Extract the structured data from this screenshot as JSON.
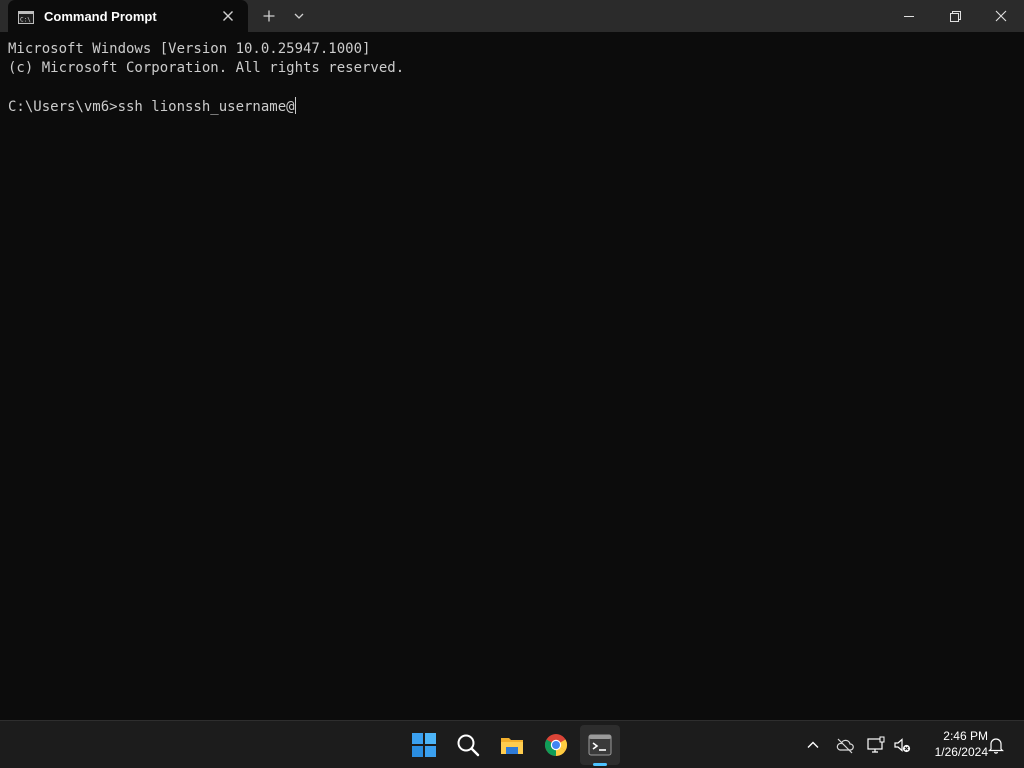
{
  "window": {
    "tab_title": "Command Prompt",
    "icons": {
      "tab_icon": "cmd-icon",
      "close_tab": "close-icon",
      "new_tab": "plus-icon",
      "dropdown": "chevron-down-icon",
      "minimize": "minimize-icon",
      "maximize": "restore-icon",
      "close": "close-icon"
    }
  },
  "terminal": {
    "lines": [
      "Microsoft Windows [Version 10.0.25947.1000]",
      "(c) Microsoft Corporation. All rights reserved.",
      "",
      "C:\\Users\\vm6>ssh lionssh_username@"
    ],
    "foreground": "#cccccc",
    "background": "#0c0c0c"
  },
  "taskbar": {
    "apps": [
      {
        "name": "start",
        "icon": "windows-start-icon"
      },
      {
        "name": "search",
        "icon": "search-icon"
      },
      {
        "name": "file-explorer",
        "icon": "folder-icon"
      },
      {
        "name": "chrome",
        "icon": "chrome-icon"
      },
      {
        "name": "terminal",
        "icon": "terminal-icon",
        "active": true
      }
    ],
    "tray": {
      "icons": [
        "chevron-up-icon",
        "cloud-offline-icon",
        "network-icon",
        "volume-muted-icon",
        "bell-icon"
      ],
      "time": "2:46 PM",
      "date": "1/26/2024"
    },
    "accent": "#4cc2ff"
  }
}
